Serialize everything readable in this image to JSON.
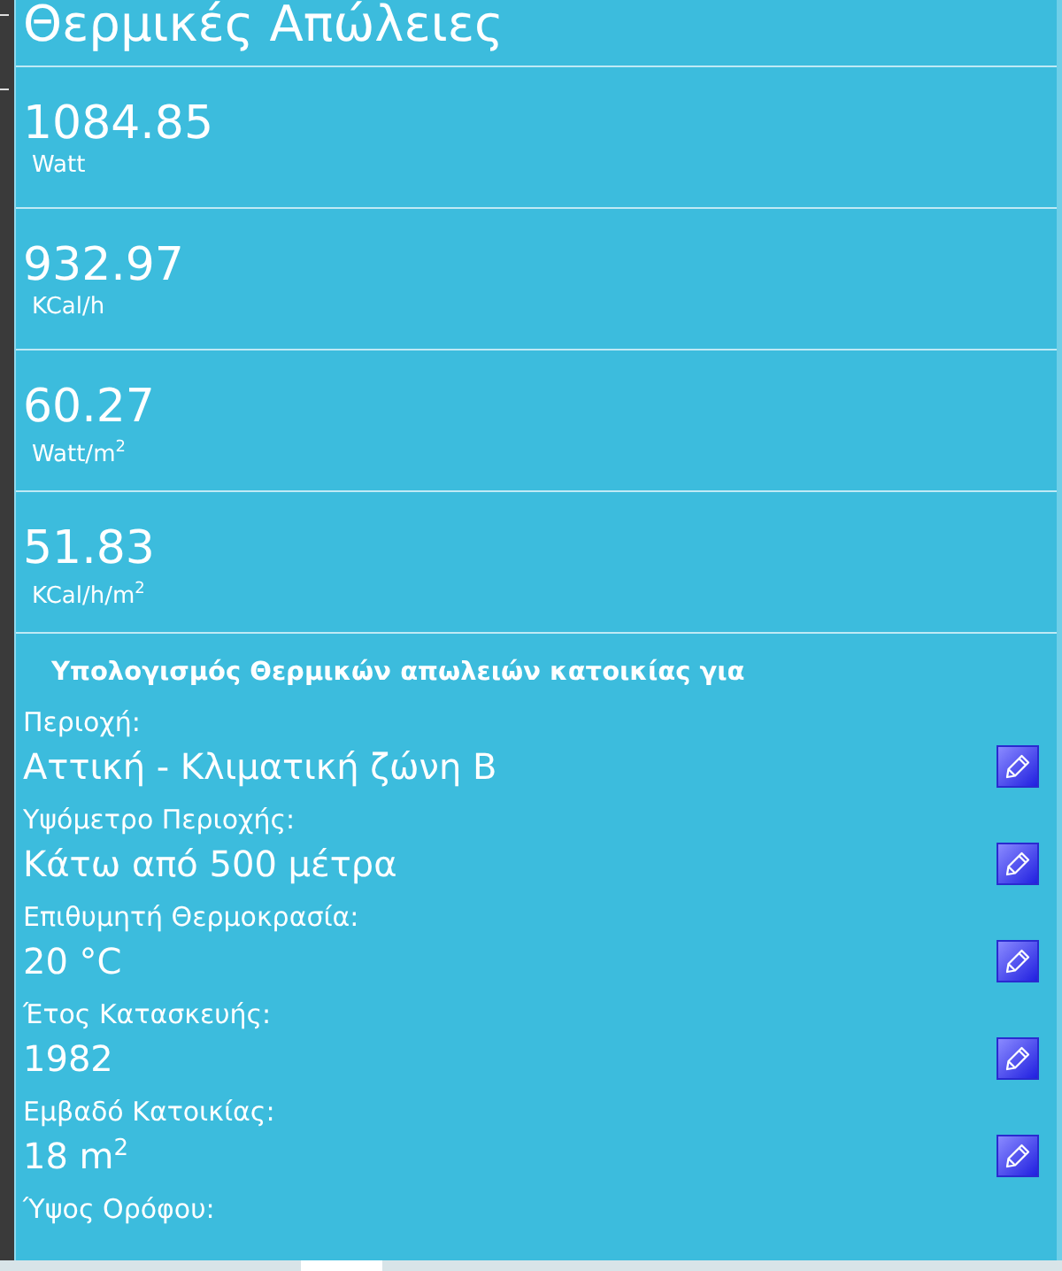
{
  "title": "Θερμικές Απώλειες",
  "results": [
    {
      "value": "1084.85",
      "unit": "Watt"
    },
    {
      "value": "932.97",
      "unit": "KCal/h"
    },
    {
      "value": "60.27",
      "unit": "Watt/m$^{2}$"
    },
    {
      "value": "51.83",
      "unit": "KCal/h/m$^{2}$"
    }
  ],
  "inputs_heading": "Υπολογισμός Θερμικών απωλειών κατοικίας για",
  "fields": [
    {
      "label": "Περιοχή:",
      "value": "Αττική - Κλιματική ζώνη Β"
    },
    {
      "label": "Υψόμετρο Περιοχής:",
      "value": "Κάτω από 500 μέτρα"
    },
    {
      "label": "Επιθυμητή Θερμοκρασία:",
      "value": "20 °C"
    },
    {
      "label": "Έτος Κατασκευής:",
      "value": "1982"
    },
    {
      "label": "Εμβαδό Κατοικίας:",
      "value": "18 m$^{2}$"
    },
    {
      "label": "Ύψος Ορόφου:"
    }
  ]
}
